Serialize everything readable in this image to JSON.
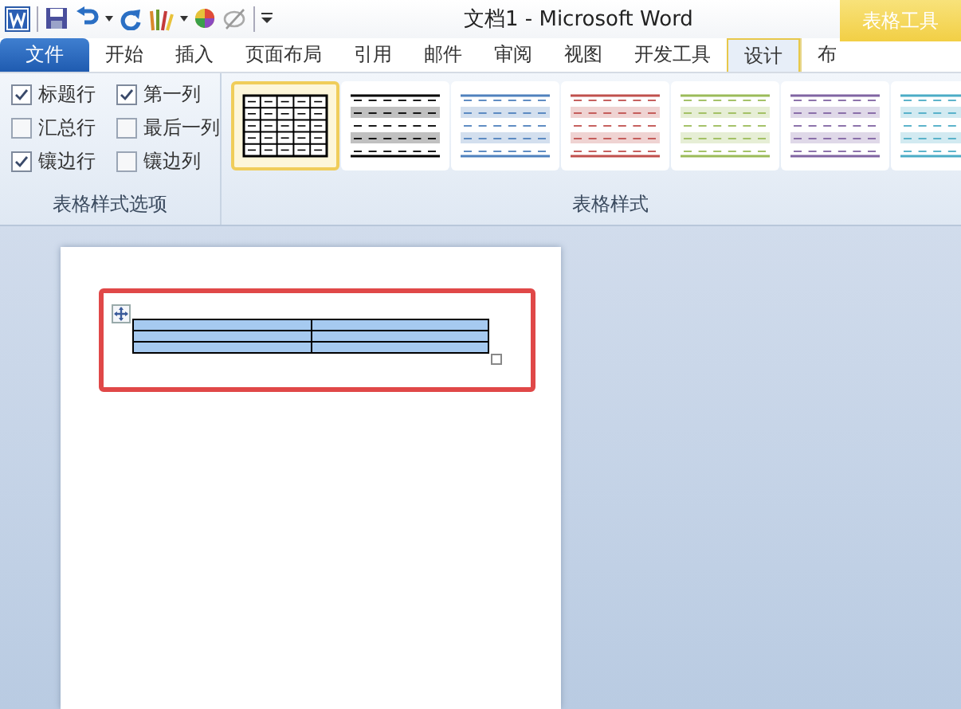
{
  "window": {
    "title": "文档1 - Microsoft Word",
    "context_group": "表格工具"
  },
  "tabs": [
    {
      "label": "文件",
      "kind": "file",
      "selected": false
    },
    {
      "label": "开始",
      "kind": "tab",
      "selected": false
    },
    {
      "label": "插入",
      "kind": "tab",
      "selected": false
    },
    {
      "label": "页面布局",
      "kind": "tab",
      "selected": false
    },
    {
      "label": "引用",
      "kind": "tab",
      "selected": false
    },
    {
      "label": "邮件",
      "kind": "tab",
      "selected": false
    },
    {
      "label": "审阅",
      "kind": "tab",
      "selected": false
    },
    {
      "label": "视图",
      "kind": "tab",
      "selected": false
    },
    {
      "label": "开发工具",
      "kind": "tab",
      "selected": false
    },
    {
      "label": "设计",
      "kind": "context",
      "selected": true
    },
    {
      "label": "布",
      "kind": "context",
      "selected": false
    }
  ],
  "options_group": {
    "label": "表格样式选项",
    "options": [
      {
        "label": "标题行",
        "checked": true
      },
      {
        "label": "汇总行",
        "checked": false
      },
      {
        "label": "镶边行",
        "checked": true
      },
      {
        "label": "第一列",
        "checked": true
      },
      {
        "label": "最后一列",
        "checked": false
      },
      {
        "label": "镶边列",
        "checked": false
      }
    ]
  },
  "styles_group": {
    "label": "表格样式",
    "styles": [
      {
        "kind": "grid",
        "color": "#000000",
        "selected": true
      },
      {
        "kind": "banded",
        "color": "#000000",
        "selected": false
      },
      {
        "kind": "banded",
        "color": "#4f81bd",
        "selected": false
      },
      {
        "kind": "banded",
        "color": "#c0504d",
        "selected": false
      },
      {
        "kind": "banded",
        "color": "#9bbb59",
        "selected": false
      },
      {
        "kind": "banded",
        "color": "#8064a2",
        "selected": false
      },
      {
        "kind": "banded",
        "color": "#4bacc6",
        "selected": false
      }
    ]
  },
  "document": {
    "table": {
      "selected": true
    },
    "highlighted": true
  }
}
